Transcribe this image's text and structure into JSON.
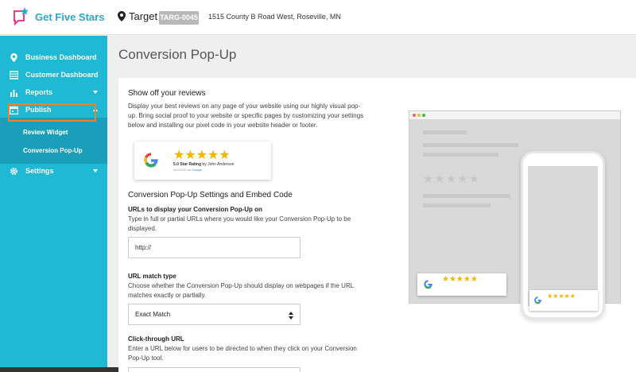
{
  "brand": {
    "name": "Get Five Stars",
    "accent": "#2aa7c9"
  },
  "location": {
    "name": "Target",
    "code": "TARG-0045",
    "address": "1515 County B Road West, Roseville, MN"
  },
  "sidebar": {
    "items": [
      {
        "label": "Business Dashboard",
        "icon": "map-pin-icon"
      },
      {
        "label": "Customer Dashboard",
        "icon": "list-icon"
      },
      {
        "label": "Reports",
        "icon": "bar-chart-icon"
      },
      {
        "label": "Publish",
        "icon": "calendar-icon"
      },
      {
        "label": "Settings",
        "icon": "gear-icon"
      }
    ],
    "subitems": [
      {
        "label": "Review Widget"
      },
      {
        "label": "Conversion Pop-Up"
      }
    ]
  },
  "main": {
    "page_title": "Conversion Pop-Up",
    "intro_heading": "Show off your reviews",
    "intro_text": "Display your best reviews on any page of your website using our highly visual pop-up. Bring social proof to your website or specific pages by customizing your settings below and installing our pixel code in your website header or footer.",
    "badge": {
      "stars": "★★★★★",
      "rating_text": "5.0 Star Rating",
      "by_text": "by John Anderson",
      "date_text": "04/22/18",
      "via_text": "via",
      "source": "Google"
    },
    "settings_heading": "Conversion Pop-Up Settings and Embed Code",
    "urls_label": "URLs to display your Conversion Pop-Up on",
    "urls_help": "Type in full or partial URLs where you would like your Conversion Pop-Up to be displayed.",
    "urls_value": "http://",
    "match_label": "URL match type",
    "match_help": "Choose whether the Conversion Pop-Up should display on webpages if the URL matches exactly or partially.",
    "match_value": "Exact Match",
    "click_label": "Click-through URL",
    "click_help": "Enter a URL below for users to be directed to when they click on your Conversion Pop-Up tool."
  }
}
